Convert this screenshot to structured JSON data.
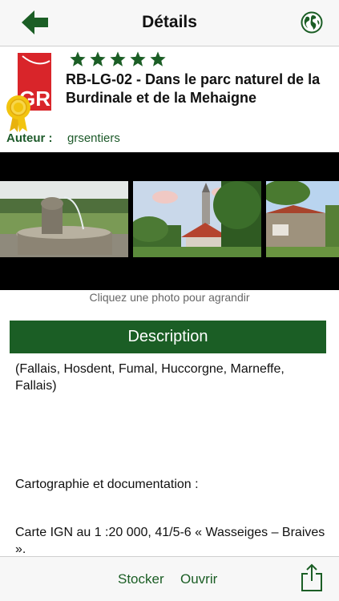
{
  "navbar": {
    "title": "Détails",
    "back_icon": "back-arrow-icon",
    "globe_icon": "globe-icon"
  },
  "header": {
    "logo_text": "GR",
    "rating": 5,
    "title": "RB-LG-02 - Dans le parc naturel de la Burdinale et de la Mehaigne",
    "author_label": "Auteur :",
    "author_value": "grsentiers"
  },
  "gallery": {
    "hint": "Cliquez une photo pour agrandir",
    "photos": [
      "fountain",
      "village-church",
      "stone-house"
    ]
  },
  "description": {
    "header": "Description",
    "paragraphs": [
      "(Fallais, Hosdent, Fumal, Huccorgne, Marneffe, Fallais)",
      "Cartographie et documentation :",
      "Carte IGN au 1 :20 000, 41/5-6 « Wasseiges – Braives »."
    ]
  },
  "toolbar": {
    "store_label": "Stocker",
    "open_label": "Ouvrir",
    "share_icon": "share-icon"
  },
  "colors": {
    "brand_green": "#1b5e25",
    "logo_red": "#d9252a",
    "medal_gold": "#f2c40f"
  }
}
